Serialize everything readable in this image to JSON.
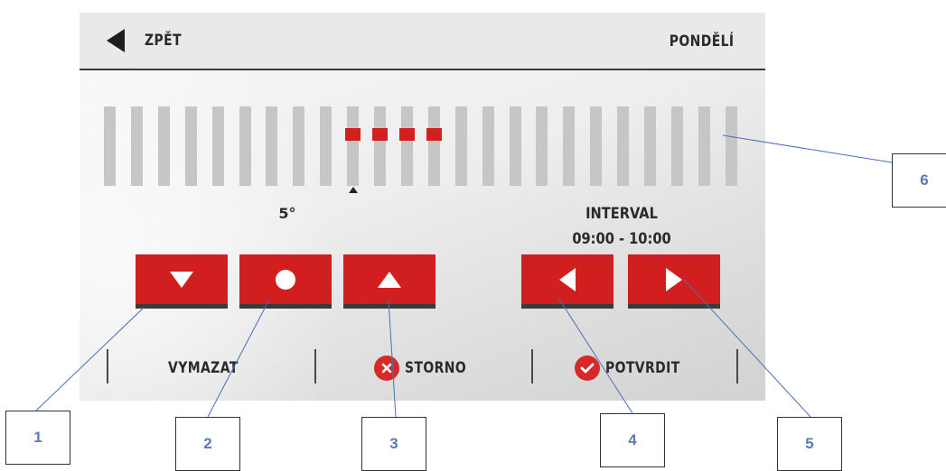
{
  "header": {
    "back_label": "ZPĚT",
    "day_label": "PONDĚLÍ"
  },
  "schedule": {
    "slot_count": 24,
    "highlighted_slots": [
      9,
      10,
      11,
      12
    ],
    "cursor_slot": 9,
    "mark_color": "#d21f1f"
  },
  "temperature": {
    "value": "5°"
  },
  "interval": {
    "label": "INTERVAL",
    "time": "09:00 - 10:00"
  },
  "controls": {
    "decrease_icon": "triangle-down-icon",
    "set_icon": "dot-icon",
    "increase_icon": "triangle-up-icon",
    "prev_icon": "triangle-left-icon",
    "next_icon": "triangle-right-icon",
    "accent_color": "#d11e1e"
  },
  "footer": {
    "delete_label": "VYMAZAT",
    "cancel_label": "STORNO",
    "confirm_label": "POTVRDIT"
  },
  "callouts": [
    "1",
    "2",
    "3",
    "4",
    "5",
    "6"
  ]
}
